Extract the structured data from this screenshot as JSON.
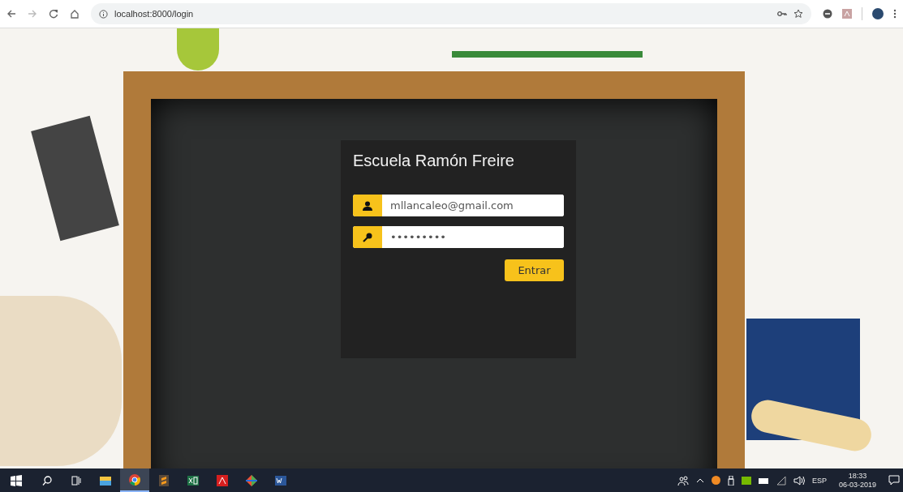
{
  "browser": {
    "url": "localhost:8000/login"
  },
  "login": {
    "title": "Escuela Ramón Freire",
    "email": {
      "value": "mllancaleo@gmail.com"
    },
    "password": {
      "value": "•••••••••"
    },
    "submit": "Entrar"
  },
  "taskbar": {
    "apps": [
      {
        "kind": "files",
        "selected": false
      },
      {
        "kind": "chrome",
        "selected": true
      },
      {
        "kind": "sublime",
        "selected": false
      },
      {
        "kind": "excel",
        "selected": false
      },
      {
        "kind": "acrobat",
        "selected": false
      },
      {
        "kind": "git",
        "selected": false
      },
      {
        "kind": "word",
        "selected": false
      }
    ],
    "language": "ESP",
    "time": "18:33",
    "date": "06-03-2019"
  }
}
